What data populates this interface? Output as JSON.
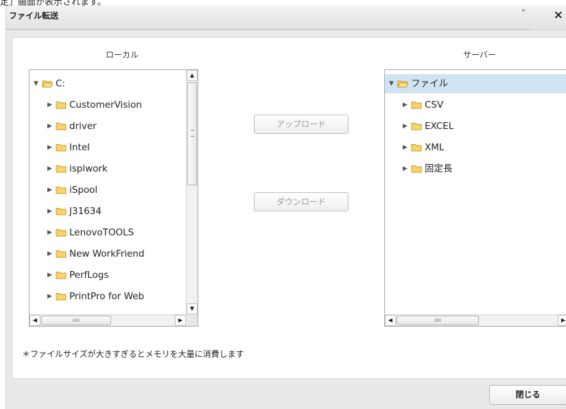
{
  "page_caption": "定」画面が表示されます。",
  "dialog": {
    "title": "ファイル転送",
    "close_symbol": "×"
  },
  "local": {
    "label": "ローカル",
    "root": "C:",
    "items": [
      "CustomerVision",
      "driver",
      "Intel",
      "isplwork",
      "iSpool",
      "J31634",
      "LenovoTOOLS",
      "New WorkFriend",
      "PerfLogs",
      "PrintPro for Web"
    ]
  },
  "server": {
    "label": "サーバー",
    "root": "ファイル",
    "items": [
      "CSV",
      "EXCEL",
      "XML",
      "固定長"
    ]
  },
  "buttons": {
    "upload": "アップロード",
    "download": "ダウンロード",
    "close": "閉じる"
  },
  "note": "＊ファイルサイズが大きすぎるとメモリを大量に消費します",
  "icons": {
    "folder": "folder-icon",
    "expand": "triangle-right-icon",
    "collapse": "triangle-down-icon"
  },
  "colors": {
    "folder_fill": "#f7d56a",
    "folder_stroke": "#c99a25",
    "selected_row": "#cfe3f3"
  }
}
